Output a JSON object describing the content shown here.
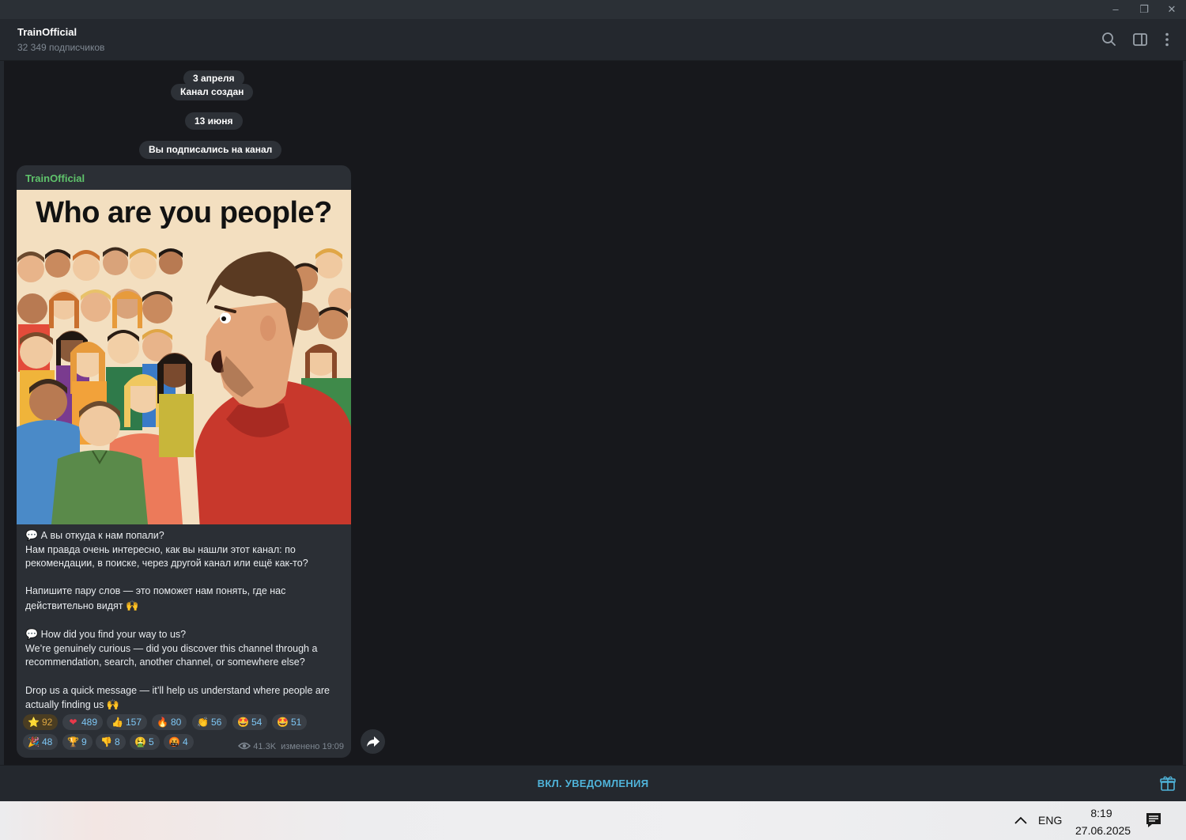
{
  "window": {
    "controls": {
      "minimize": "–",
      "restore": "❐",
      "close": "✕"
    }
  },
  "header": {
    "title": "TrainOfficial",
    "subtitle": "32 349 подписчиков",
    "icons": [
      "search-icon",
      "sidebar-toggle-icon",
      "more-vertical-icon"
    ]
  },
  "service": {
    "date1": "3 апреля",
    "created": "Канал создан",
    "date2": "13 июня",
    "subscribed": "Вы подписались на канал"
  },
  "post": {
    "author": "TrainOfficial",
    "image_caption": "Who are you people?",
    "paragraphs": {
      "ru_q": "А вы откуда к нам попали?",
      "ru_1": "Нам правда очень интересно, как вы нашли этот канал: по",
      "ru_2": "рекомендации, в поиске, через другой канал или ещё как-то?",
      "ru_3": "Напишите пару слов — это поможет нам понять, где нас",
      "ru_4": "действительно видят",
      "en_q": "How did you find your way to us?",
      "en_1": "We’re genuinely curious — did you discover this channel through a",
      "en_2": "recommendation, search, another channel, or somewhere else?",
      "en_3": "Drop us a quick message — it’ll help us understand where people are",
      "en_4": "actually finding us"
    },
    "emoji": {
      "speech": "💬",
      "raised_hands": "🙌"
    },
    "reactions": [
      {
        "icon": "⭐",
        "count": "92"
      },
      {
        "icon": "❤",
        "count": "489"
      },
      {
        "icon": "👍",
        "count": "157"
      },
      {
        "icon": "🔥",
        "count": "80"
      },
      {
        "icon": "👏",
        "count": "56"
      },
      {
        "icon": "🤩",
        "count": "54"
      },
      {
        "icon": "🤩",
        "count": "51"
      },
      {
        "icon": "🎉",
        "count": "48"
      },
      {
        "icon": "🏆",
        "count": "9"
      },
      {
        "icon": "👎",
        "count": "8"
      },
      {
        "icon": "🤮",
        "count": "5"
      },
      {
        "icon": "🤬",
        "count": "4"
      }
    ],
    "views": "41.3K",
    "edited": "изменено 19:09"
  },
  "bottom": {
    "notify_label": "ВКЛ. УВЕДОМЛЕНИЯ"
  },
  "taskbar": {
    "lang": "ENG",
    "time": "8:19",
    "date": "27.06.2025"
  },
  "colors": {
    "accent": "#4fb3d9",
    "author": "#5fc36b",
    "bubble": "#2b2f35",
    "background": "#17181c"
  }
}
